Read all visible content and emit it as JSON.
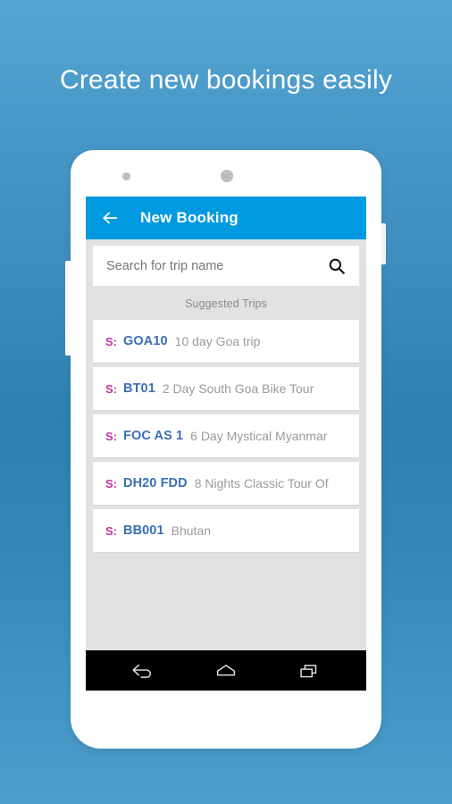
{
  "headline": "Create new bookings easily",
  "colors": {
    "accent": "#019ae0",
    "background_top": "#57a5d0",
    "background_bottom": "#4e9ecb",
    "screen_background": "#e2e2e2",
    "trip_prefix": "#c4339d",
    "trip_code": "#3a6fb4",
    "trip_desc": "#9a9a9a"
  },
  "appbar": {
    "back_icon": "arrow-left-icon",
    "title": "New Booking"
  },
  "search": {
    "value": "",
    "placeholder": "Search for trip name",
    "icon": "search-icon"
  },
  "section": {
    "label": "Suggested Trips"
  },
  "trips": [
    {
      "prefix": "S:",
      "code": "GOA10",
      "desc": "10 day Goa trip"
    },
    {
      "prefix": "S:",
      "code": "BT01",
      "desc": "2 Day South Goa Bike Tour"
    },
    {
      "prefix": "S:",
      "code": "FOC AS 1",
      "desc": "6 Day Mystical Myanmar"
    },
    {
      "prefix": "S:",
      "code": "DH20 FDD",
      "desc": "8 Nights Classic Tour Of"
    },
    {
      "prefix": "S:",
      "code": "BB001",
      "desc": "Bhutan"
    }
  ],
  "navbar": {
    "back": "nav-back-icon",
    "home": "nav-home-icon",
    "recents": "nav-recents-icon"
  },
  "device": {
    "camera": "camera-dot",
    "earpiece": "earpiece-dot",
    "power": "power-button",
    "volume": "volume-rocker"
  }
}
